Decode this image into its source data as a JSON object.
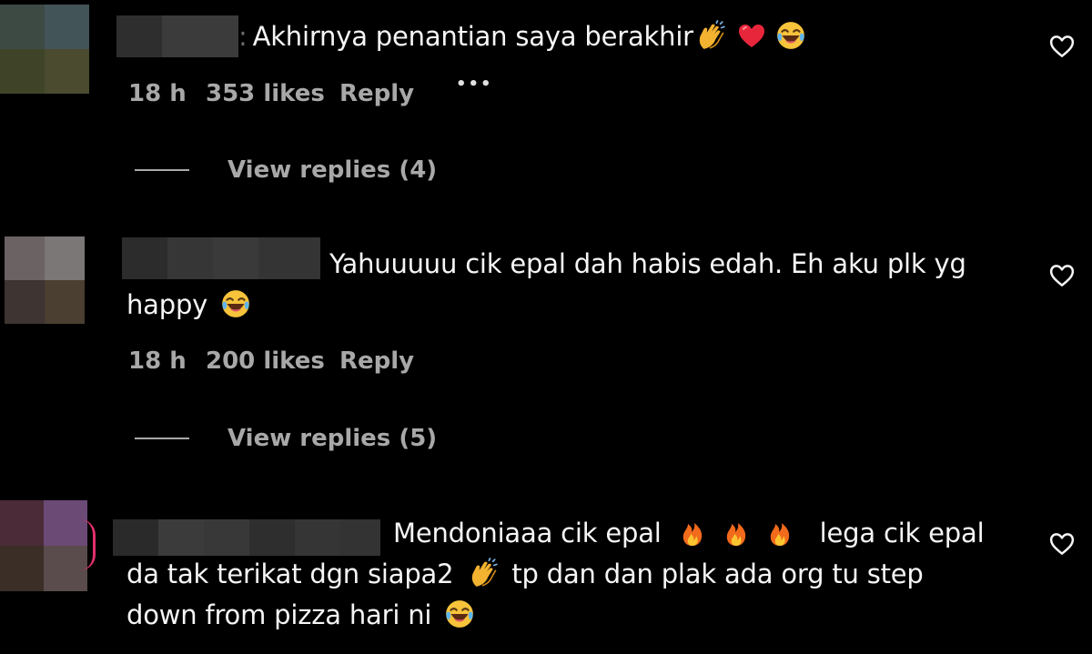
{
  "comments": [
    {
      "line1": "Akhirnya penantian saya berakhir",
      "time": "18 h",
      "likes": "353 likes",
      "reply": "Reply",
      "more": "•••",
      "view_replies": "View replies (4)"
    },
    {
      "line1": "Yahuuuuu cik epal dah habis edah. Eh aku plk yg",
      "line2": "happy",
      "time": "18 h",
      "likes": "200 likes",
      "reply": "Reply",
      "view_replies": "View replies (5)"
    },
    {
      "line1a": "Mendoniaaa cik epal",
      "line1b": "lega cik epal",
      "line2a": "da tak terikat dgn siapa2",
      "line2b": "tp dan dan plak ada org tu step",
      "line3": "down from pizza hari ni"
    }
  ],
  "icons": {
    "heart": "heart-outline-icon",
    "clap": "clapping-hands-emoji",
    "red_heart": "red-heart-emoji",
    "laugh": "tears-of-joy-emoji",
    "fire": "fire-emoji"
  },
  "colors": {
    "background": "#000000",
    "text": "#f5f5f5",
    "muted": "#a8a8a8",
    "story_ring": "#e1306c"
  }
}
